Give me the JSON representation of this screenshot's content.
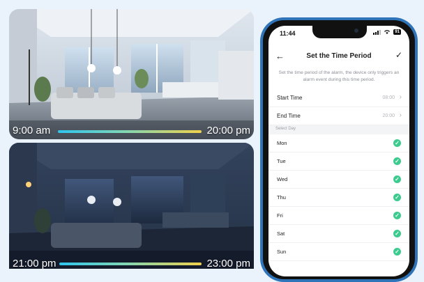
{
  "day_panel": {
    "start_time": "9:00 am",
    "end_time": "20:00 pm",
    "progress": 0.6
  },
  "night_panel": {
    "start_time": "21:00 pm",
    "end_time": "23:00 pm",
    "progress": 0.6
  },
  "phone": {
    "status": {
      "time": "11:44",
      "battery": "91"
    },
    "nav": {
      "back_icon": "←",
      "title": "Set the Time Period",
      "done_icon": "✓"
    },
    "description": "Set the time period of the alarm, the device only triggers an alarm event during this time period.",
    "start_time": {
      "label": "Start Time",
      "value": "08:00"
    },
    "end_time": {
      "label": "End Time",
      "value": "20:00"
    },
    "select_day_label": "Select Day",
    "days": [
      "Mon",
      "Tue",
      "Wed",
      "Thu",
      "Fri",
      "Sat",
      "Sun"
    ]
  },
  "colors": {
    "accent": "#3ccb8e",
    "phone_frame": "#2f73b8",
    "background": "#eaf3fb"
  }
}
